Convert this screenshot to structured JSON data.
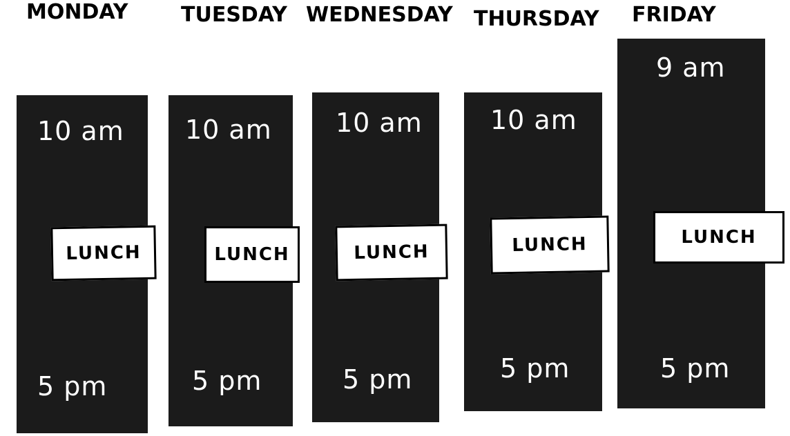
{
  "schedule": {
    "days": [
      {
        "day": "MONDAY",
        "start": "10 am",
        "lunch": "LUNCH",
        "end": "5 pm"
      },
      {
        "day": "TUESDAY",
        "start": "10 am",
        "lunch": "LUNCH",
        "end": "5 pm"
      },
      {
        "day": "WEDNESDAY",
        "start": "10 am",
        "lunch": "LUNCH",
        "end": "5 pm"
      },
      {
        "day": "THURSDAY",
        "start": "10 am",
        "lunch": "LUNCH",
        "end": "5 pm"
      },
      {
        "day": "FRIDAY",
        "start": "9 am",
        "lunch": "LUNCH",
        "end": "5 pm"
      }
    ]
  },
  "colors": {
    "column": "#1b1b1b",
    "background": "#ffffff",
    "lunch_box": "#ffffff",
    "text_on_column": "#ffffff",
    "heading": "#000000"
  }
}
